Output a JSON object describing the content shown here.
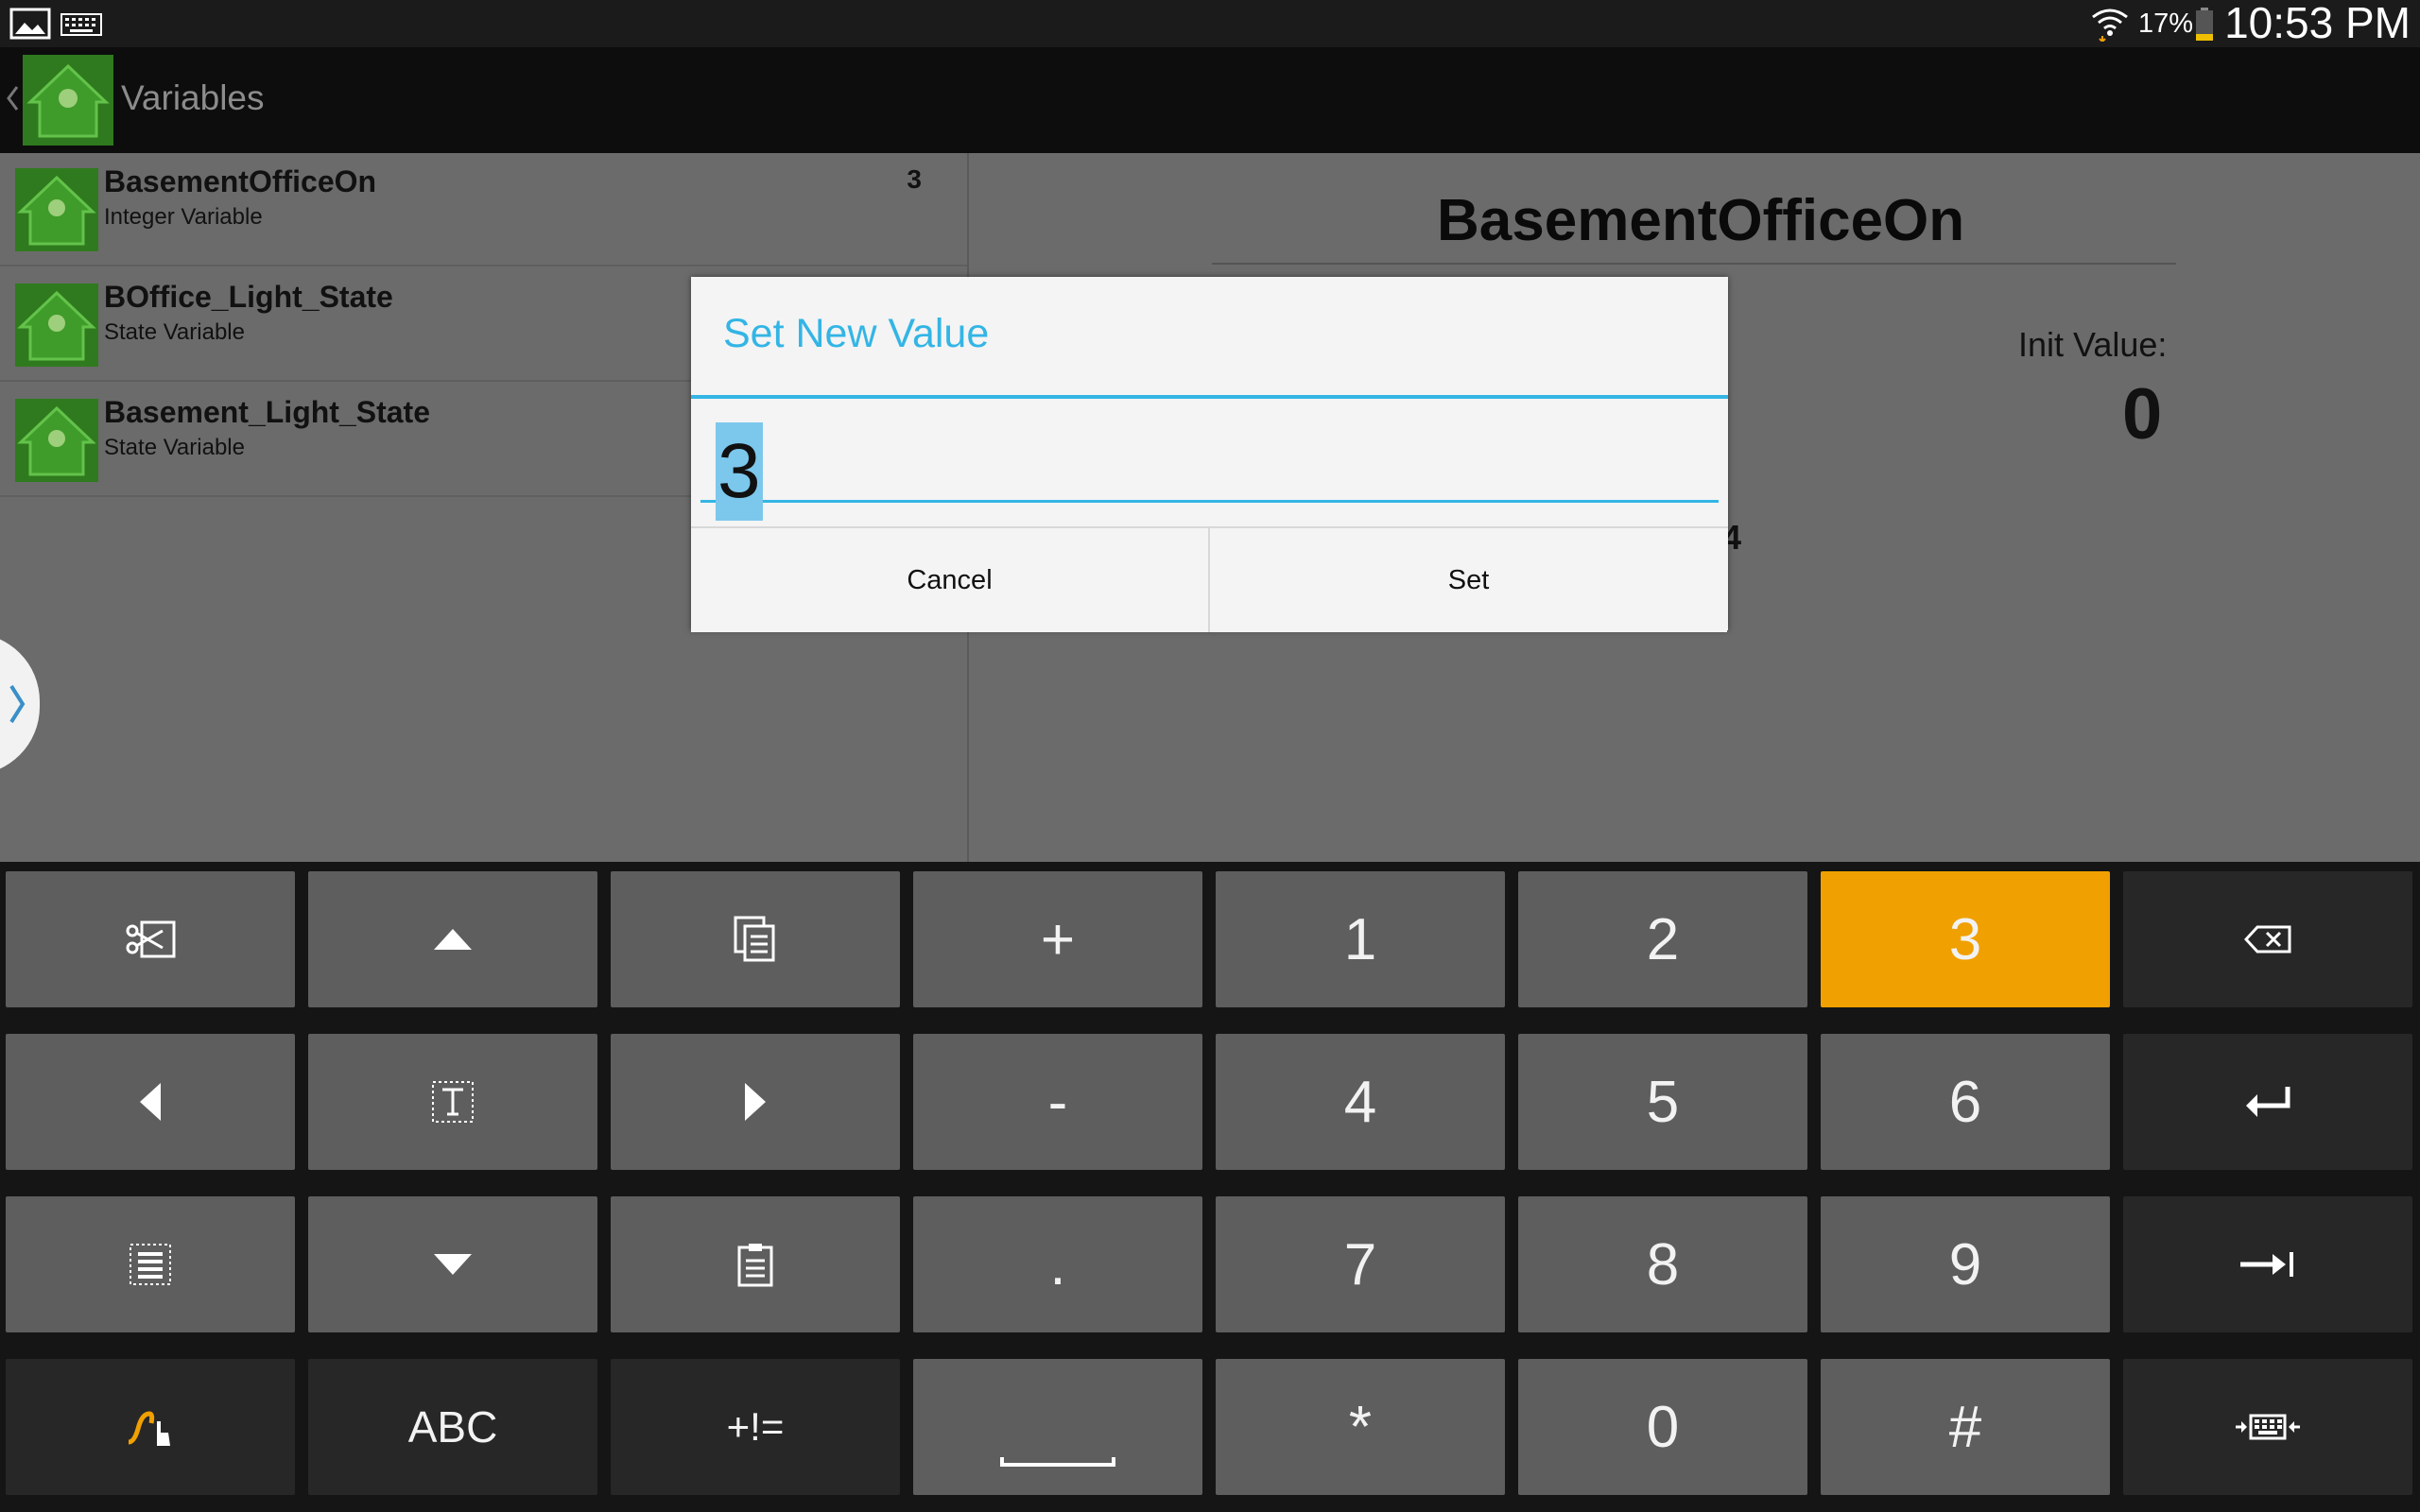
{
  "status_bar": {
    "battery": "17%",
    "time": "10:53 PM"
  },
  "action_bar": {
    "title": "Variables"
  },
  "variables": [
    {
      "name": "BasementOfficeOn",
      "type": "Integer Variable",
      "value": "3"
    },
    {
      "name": "BOffice_Light_State",
      "type": "State Variable",
      "value": ""
    },
    {
      "name": "Basement_Light_State",
      "type": "State Variable",
      "value": ""
    }
  ],
  "detail": {
    "title": "BasementOfficeOn",
    "init_label": "Init Value:",
    "init_value": "0",
    "partial_value": "4"
  },
  "dialog": {
    "title": "Set New Value",
    "input_value": "3",
    "cancel_label": "Cancel",
    "set_label": "Set"
  },
  "keyboard": {
    "rows": [
      [
        {
          "icon": "cut-icon"
        },
        {
          "icon": "arrow-up-icon"
        },
        {
          "icon": "copy-icon"
        },
        {
          "label": "+"
        },
        {
          "label": "1"
        },
        {
          "label": "2"
        },
        {
          "label": "3",
          "highlight": "#f0a000"
        },
        {
          "icon": "backspace-icon"
        }
      ],
      [
        {
          "icon": "arrow-left-icon"
        },
        {
          "icon": "text-select-icon"
        },
        {
          "icon": "arrow-right-icon"
        },
        {
          "label": "-"
        },
        {
          "label": "4"
        },
        {
          "label": "5"
        },
        {
          "label": "6"
        },
        {
          "icon": "enter-icon"
        }
      ],
      [
        {
          "icon": "select-all-icon"
        },
        {
          "icon": "arrow-down-icon"
        },
        {
          "icon": "paste-icon"
        },
        {
          "label": "."
        },
        {
          "label": "7"
        },
        {
          "label": "8"
        },
        {
          "label": "9"
        },
        {
          "icon": "tab-icon"
        }
      ],
      [
        {
          "icon": "handwriting-icon"
        },
        {
          "label": "ABC"
        },
        {
          "label": "+!="
        },
        {
          "icon": "space-icon"
        },
        {
          "label": "*"
        },
        {
          "label": "0"
        },
        {
          "label": "#"
        },
        {
          "icon": "keyboard-settings-icon"
        }
      ]
    ]
  },
  "colors": {
    "accent": "#33b5e5",
    "key_highlight": "#f0a000",
    "key": "#5e5e5e",
    "key_dark": "#272727"
  }
}
